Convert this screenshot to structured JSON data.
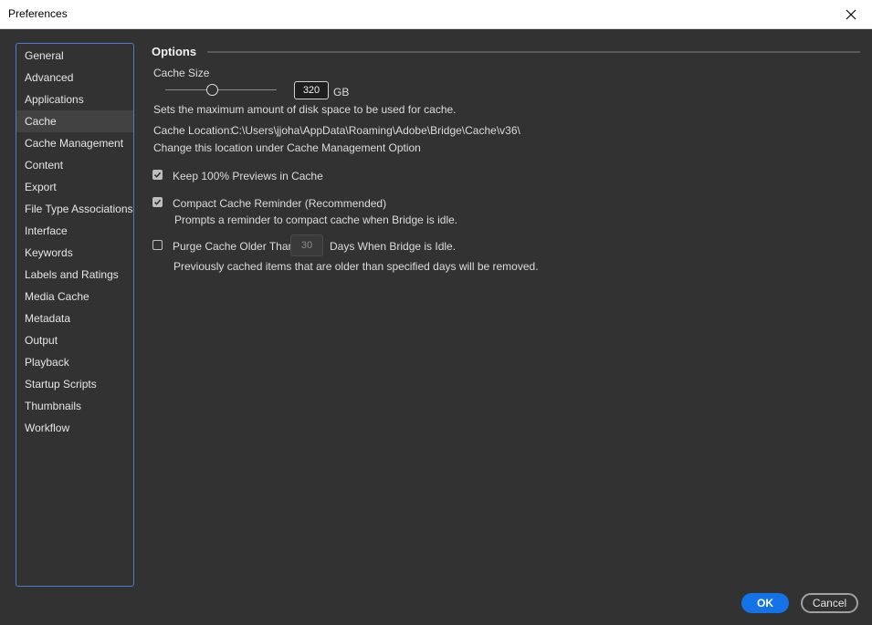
{
  "window": {
    "title": "Preferences"
  },
  "sidebar": {
    "items": [
      {
        "label": "General"
      },
      {
        "label": "Advanced"
      },
      {
        "label": "Applications"
      },
      {
        "label": "Cache"
      },
      {
        "label": "Cache Management"
      },
      {
        "label": "Content"
      },
      {
        "label": "Export"
      },
      {
        "label": "File Type Associations"
      },
      {
        "label": "Interface"
      },
      {
        "label": "Keywords"
      },
      {
        "label": "Labels and Ratings"
      },
      {
        "label": "Media Cache"
      },
      {
        "label": "Metadata"
      },
      {
        "label": "Output"
      },
      {
        "label": "Playback"
      },
      {
        "label": "Startup Scripts"
      },
      {
        "label": "Thumbnails"
      },
      {
        "label": "Workflow"
      }
    ],
    "selected": "Cache"
  },
  "options": {
    "header": "Options",
    "cache_size_label": "Cache Size",
    "cache_size_value": "320",
    "cache_size_unit": "GB",
    "cache_size_desc": "Sets the maximum amount of disk space to be used for cache.",
    "cache_location_label": "Cache Location:",
    "cache_location_path": "C:\\Users\\jjoha\\AppData\\Roaming\\Adobe\\Bridge\\Cache\\v36\\",
    "cache_location_desc": "Change this location under Cache Management Option",
    "keep_previews_label": "Keep 100% Previews in Cache",
    "keep_previews_checked": true,
    "compact_reminder_label": "Compact Cache Reminder (Recommended)",
    "compact_reminder_checked": true,
    "compact_reminder_desc": "Prompts a reminder to compact cache when Bridge is idle.",
    "purge_label": "Purge Cache Older Than",
    "purge_checked": false,
    "purge_days": "30",
    "purge_suffix": "Days When Bridge is Idle.",
    "purge_desc": "Previously cached items that are older than specified days will be removed."
  },
  "buttons": {
    "ok": "OK",
    "cancel": "Cancel"
  },
  "colors": {
    "accent": "#1473e6",
    "sidebar_border": "#4b7bd1",
    "background": "#323232"
  }
}
